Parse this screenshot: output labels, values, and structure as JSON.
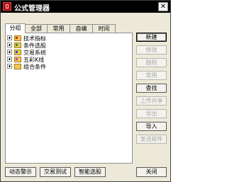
{
  "window": {
    "title": "公式管理器",
    "close_glyph": "✕"
  },
  "tabs": [
    "分组",
    "全部",
    "常用",
    "自编",
    "时间"
  ],
  "active_tab": 0,
  "tree": [
    {
      "label": "技术指标",
      "expander": "+"
    },
    {
      "label": "条件选股",
      "expander": "+"
    },
    {
      "label": "交易系统",
      "expander": "+"
    },
    {
      "label": "五彩K线",
      "expander": "+"
    },
    {
      "label": "组合条件",
      "expander": "+"
    }
  ],
  "side_buttons": [
    {
      "label": "新建",
      "enabled": true
    },
    {
      "label": "修改",
      "enabled": false
    },
    {
      "label": "删除",
      "enabled": false
    },
    {
      "label": "常用",
      "enabled": false
    },
    {
      "label": "查找",
      "enabled": true
    },
    {
      "label": "上传共享",
      "enabled": false
    },
    {
      "label": "导出",
      "enabled": false
    },
    {
      "label": "导入",
      "enabled": true
    },
    {
      "label": "发送邮件",
      "enabled": false
    }
  ],
  "bottom_buttons": {
    "auto_alert": "动态警示",
    "trade_test": "交易测试",
    "smart_select": "智能选股",
    "close": "关闭"
  }
}
